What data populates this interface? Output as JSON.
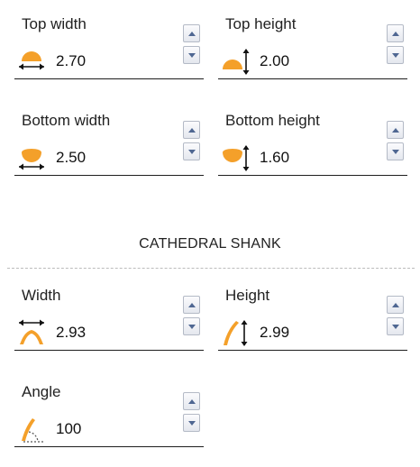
{
  "fields": {
    "top_width": {
      "label": "Top width",
      "value": "2.70",
      "icon": "top-width-icon"
    },
    "top_height": {
      "label": "Top height",
      "value": "2.00",
      "icon": "top-height-icon"
    },
    "bottom_width": {
      "label": "Bottom width",
      "value": "2.50",
      "icon": "bottom-width-icon"
    },
    "bottom_height": {
      "label": "Bottom height",
      "value": "1.60",
      "icon": "bottom-height-icon"
    }
  },
  "shank": {
    "title": "CATHEDRAL SHANK",
    "width": {
      "label": "Width",
      "value": "2.93",
      "icon": "shank-width-icon"
    },
    "height": {
      "label": "Height",
      "value": "2.99",
      "icon": "shank-height-icon"
    },
    "angle": {
      "label": "Angle",
      "value": "100",
      "icon": "shank-angle-icon"
    }
  },
  "colors": {
    "accent_orange": "#f4a02a",
    "arrow": "#111111",
    "spinner_arrow": "#4f6792"
  }
}
